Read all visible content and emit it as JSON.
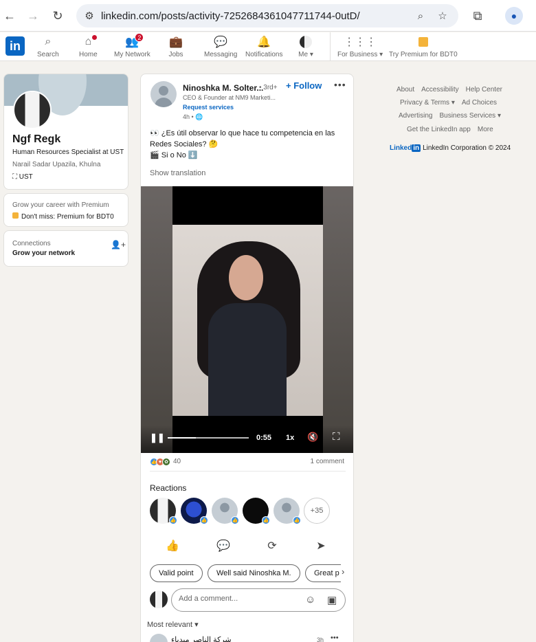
{
  "browser": {
    "url": "linkedin.com/posts/activity-7252684361047711744-0utD/"
  },
  "nav": {
    "search": "Search",
    "home": "Home",
    "home_badge": "",
    "network": "My Network",
    "network_badge": "2",
    "jobs": "Jobs",
    "messaging": "Messaging",
    "notifications": "Notifications",
    "me": "Me",
    "for_business": "For Business",
    "premium": "Try Premium for BDT0"
  },
  "profile": {
    "name": "Ngf Regk",
    "headline": "Human Resources Specialist at UST",
    "location": "Narail Sadar Upazila, Khulna",
    "company": "UST"
  },
  "premium_card": {
    "line1": "Grow your career with Premium",
    "line2": "Don't miss: Premium for BDT0"
  },
  "connections_card": {
    "title": "Connections",
    "subtitle": "Grow your network"
  },
  "post": {
    "author": "Ninoshka M. Solter...",
    "degree": "• 3rd+",
    "author_title": "CEO & Founder at NM9 Marketi...",
    "request_services": "Request services",
    "time": "4h •",
    "follow": "+ Follow",
    "text_line1": "👀 ¿Es útil observar lo que hace tu competencia en las Redes Sociales? 🤔",
    "text_line2": "🎬 Si o No ⬇️",
    "show_translation": "Show translation",
    "video": {
      "time": "0:55",
      "speed": "1x",
      "progress": 0.35
    },
    "reaction_count": "40",
    "comment_count": "1 comment",
    "reactions_title": "Reactions",
    "more_reactors": "+35",
    "chips": [
      "Valid point",
      "Well said Ninoshka M.",
      "Great p"
    ],
    "comment_placeholder": "Add a comment...",
    "sort": "Most relevant",
    "next_comment_name": "شركة الناصر مبدياء",
    "next_comment_time": "3h"
  },
  "footer": {
    "about": "About",
    "accessibility": "Accessibility",
    "help": "Help Center",
    "privacy": "Privacy & Terms",
    "ad_choices": "Ad Choices",
    "advertising": "Advertising",
    "business_services": "Business Services",
    "get_app": "Get the LinkedIn app",
    "more": "More",
    "brand_word": "Linked",
    "brand_in": "in",
    "copyright": "LinkedIn Corporation © 2024"
  },
  "colors": {
    "linkedin_blue": "#0a66c2",
    "badge_red": "#cb112d",
    "background": "#f4f2ee"
  }
}
